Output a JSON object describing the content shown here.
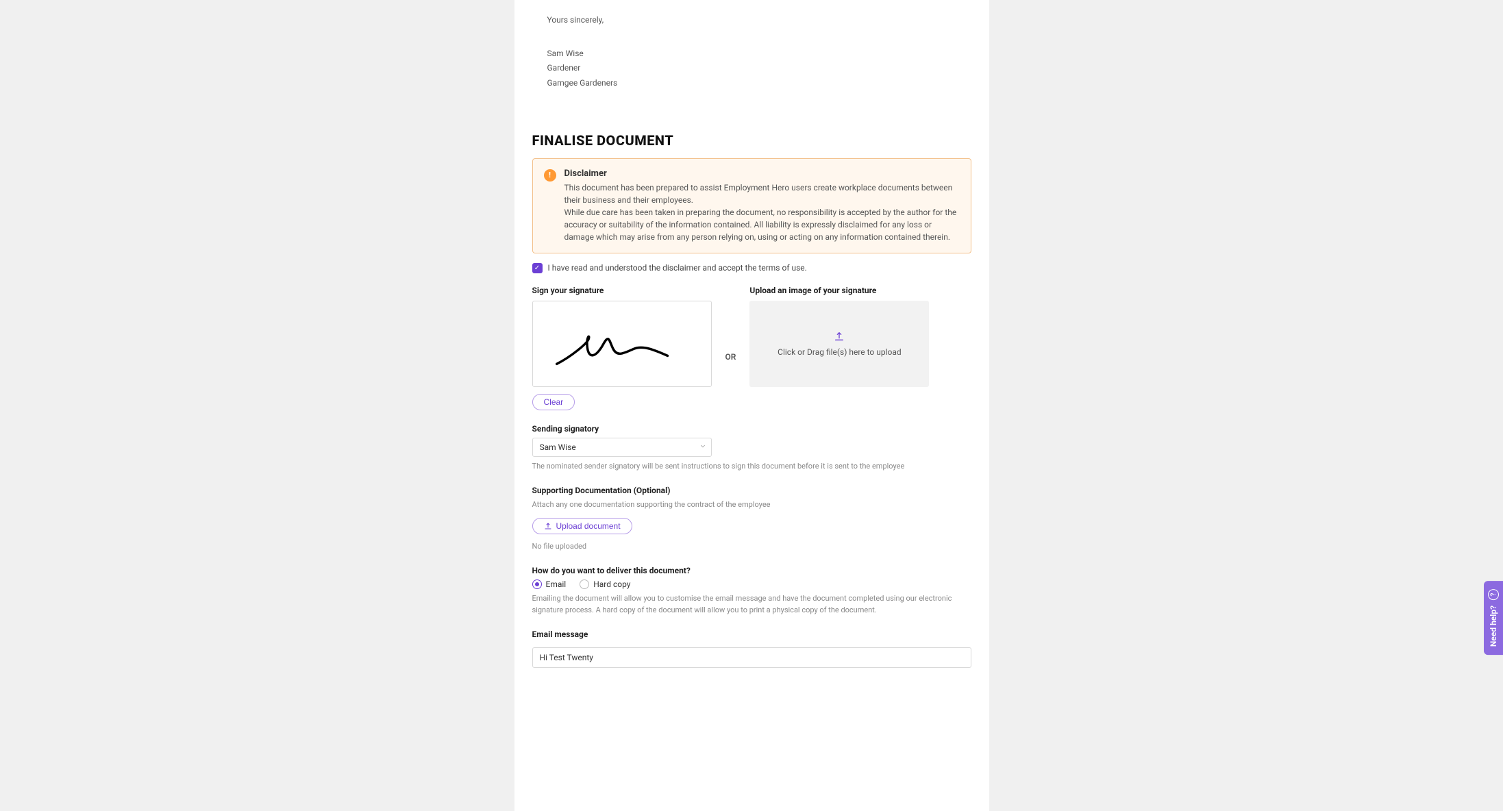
{
  "letter": {
    "closing": "Yours sincerely,",
    "name": "Sam  Wise",
    "title": "Gardener",
    "company": "Gamgee Gardeners"
  },
  "section": {
    "heading": "Finalise Document"
  },
  "disclaimer": {
    "title": "Disclaimer",
    "p1": "This document has been prepared to assist Employment Hero users create workplace documents between their business and their employees.",
    "p2": "While due care has been taken in preparing the document, no responsibility is accepted by the author for the accuracy or suitability of the information contained. All liability is expressly disclaimed for any loss or damage which may arise from any person relying on, using or acting on any information contained therein."
  },
  "terms": {
    "label": "I have read and understood the disclaimer and accept the terms of use."
  },
  "signature": {
    "sign_label": "Sign your signature",
    "upload_label": "Upload an image of your signature",
    "or": "OR",
    "upload_hint": "Click or Drag file(s) here to upload",
    "clear_label": "Clear"
  },
  "signatory": {
    "label": "Sending signatory",
    "selected": "Sam Wise",
    "help": "The nominated sender signatory will be sent instructions to sign this document before it is sent to the employee"
  },
  "supporting": {
    "label": "Supporting Documentation (Optional)",
    "help": "Attach any one documentation supporting the contract of the employee",
    "upload_button": "Upload document",
    "no_file": "No file uploaded"
  },
  "delivery": {
    "label": "How do you want to deliver this document?",
    "option_email": "Email",
    "option_hardcopy": "Hard copy",
    "help": "Emailing the document will allow you to customise the email message and have the document completed using our electronic signature process. A hard copy of the document will allow you to print a physical copy of the document."
  },
  "email_message": {
    "label": "Email message",
    "value": "Hi Test Twenty"
  },
  "help_tab": {
    "label": "Need help?"
  }
}
